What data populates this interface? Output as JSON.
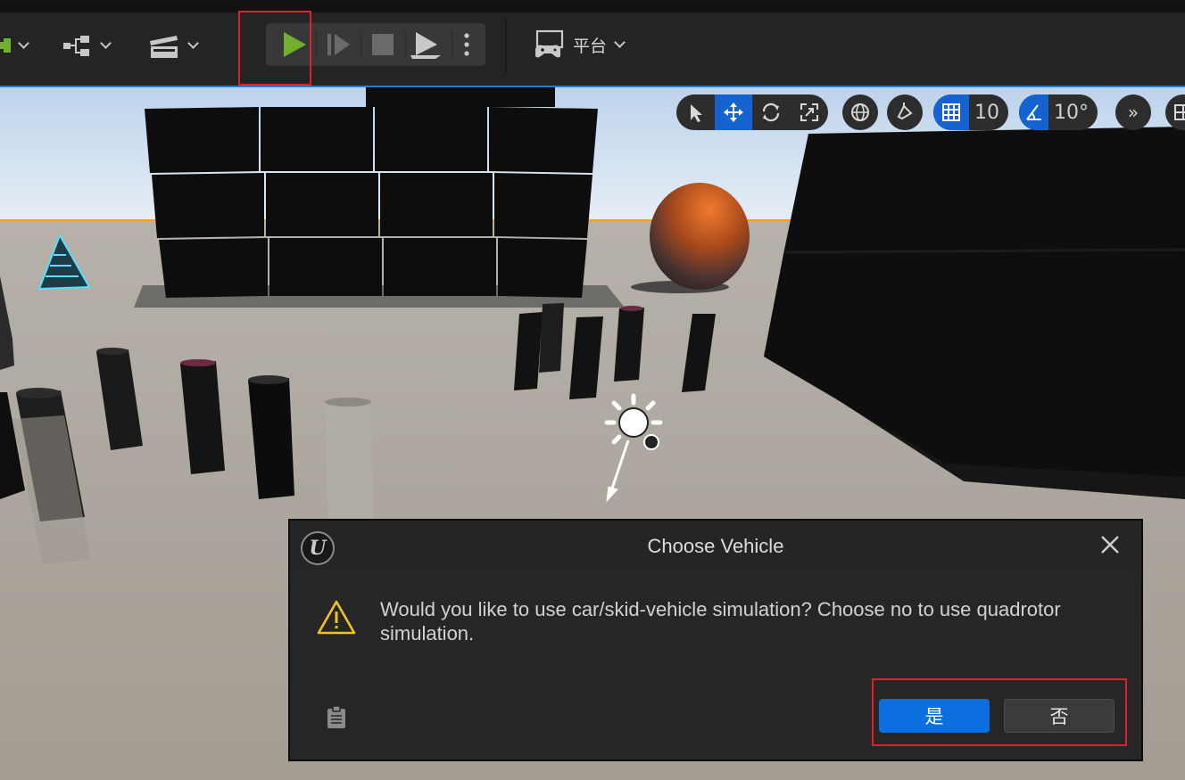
{
  "toolbar": {
    "platform_label": "平台",
    "play_tooltip": "Play",
    "colors": {
      "play_green": "#6fb12f",
      "highlight_red": "#e3202a"
    }
  },
  "viewport_tools": {
    "grid_snap_value": "10",
    "angle_snap_value": "10°",
    "accent": "#1463d0"
  },
  "dialog": {
    "title": "Choose Vehicle",
    "message": "Would you like to use car/skid-vehicle simulation? Choose no to use quadrotor simulation.",
    "yes_label": "是",
    "no_label": "否",
    "logo_glyph": "U"
  }
}
